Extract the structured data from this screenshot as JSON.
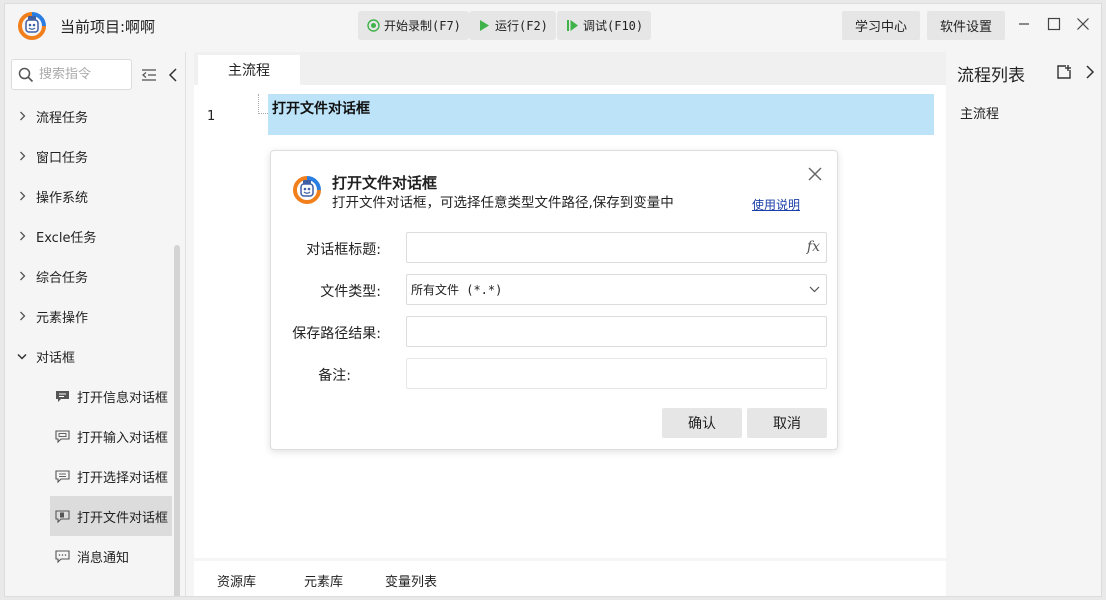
{
  "header": {
    "project_title": "当前项目:啊啊",
    "record_label": "开始录制(F7)",
    "run_label": "运行(F2)",
    "debug_label": "调试(F10)",
    "learning_center": "学习中心",
    "software_settings": "软件设置"
  },
  "sidebar": {
    "search_placeholder": "搜索指令",
    "categories": [
      {
        "label": "流程任务"
      },
      {
        "label": "窗口任务"
      },
      {
        "label": "操作系统"
      },
      {
        "label": "Excle任务"
      },
      {
        "label": "综合任务"
      },
      {
        "label": "元素操作"
      },
      {
        "label": "对话框"
      }
    ],
    "dialog_items": [
      {
        "label": "打开信息对话框"
      },
      {
        "label": "打开输入对话框"
      },
      {
        "label": "打开选择对话框"
      },
      {
        "label": "打开文件对话框"
      },
      {
        "label": "消息通知"
      }
    ]
  },
  "editor": {
    "tab_label": "主流程",
    "line_number": "1",
    "step_label": "打开文件对话框"
  },
  "dialog": {
    "title": "打开文件对话框",
    "description": "打开文件对话框，可选择任意类型文件路径,保存到变量中",
    "help_link": "使用说明",
    "fields": {
      "title_label": "对话框标题:",
      "title_value": "",
      "filetype_label": "文件类型:",
      "filetype_value": "所有文件 (*.*)",
      "save_label": "保存路径结果:",
      "save_value": "",
      "note_label": "备注:",
      "note_value": ""
    },
    "fx_label": "fx",
    "confirm": "确认",
    "cancel": "取消"
  },
  "bottom_tabs": [
    "资源库",
    "元素库",
    "变量列表"
  ],
  "right_panel": {
    "title": "流程列表",
    "items": [
      "主流程"
    ]
  },
  "colors": {
    "selection": "#bde3f9",
    "link": "#1a3fa8",
    "play_green": "#3fb34a"
  }
}
